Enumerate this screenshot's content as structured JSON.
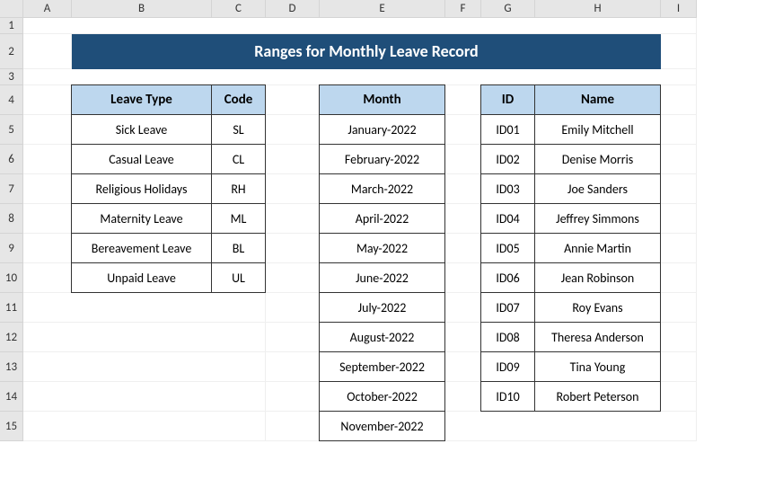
{
  "columns": [
    "A",
    "B",
    "C",
    "D",
    "E",
    "F",
    "G",
    "H",
    "I"
  ],
  "rows": [
    "1",
    "2",
    "3",
    "4",
    "5",
    "6",
    "7",
    "8",
    "9",
    "10",
    "11",
    "12",
    "13",
    "14",
    "15"
  ],
  "title": "Ranges for Monthly Leave Record",
  "leaveTable": {
    "headers": {
      "type": "Leave Type",
      "code": "Code"
    },
    "rows": [
      {
        "type": "Sick Leave",
        "code": "SL"
      },
      {
        "type": "Casual Leave",
        "code": "CL"
      },
      {
        "type": "Religious Holidays",
        "code": "RH"
      },
      {
        "type": "Maternity Leave",
        "code": "ML"
      },
      {
        "type": "Bereavement Leave",
        "code": "BL"
      },
      {
        "type": "Unpaid Leave",
        "code": "UL"
      }
    ]
  },
  "monthTable": {
    "header": "Month",
    "rows": [
      "January-2022",
      "February-2022",
      "March-2022",
      "April-2022",
      "May-2022",
      "June-2022",
      "July-2022",
      "August-2022",
      "September-2022",
      "October-2022",
      "November-2022"
    ]
  },
  "employeeTable": {
    "headers": {
      "id": "ID",
      "name": "Name"
    },
    "rows": [
      {
        "id": "ID01",
        "name": "Emily Mitchell"
      },
      {
        "id": "ID02",
        "name": "Denise Morris"
      },
      {
        "id": "ID03",
        "name": "Joe Sanders"
      },
      {
        "id": "ID04",
        "name": "Jeffrey Simmons"
      },
      {
        "id": "ID05",
        "name": "Annie Martin"
      },
      {
        "id": "ID06",
        "name": "Jean Robinson"
      },
      {
        "id": "ID07",
        "name": "Roy Evans"
      },
      {
        "id": "ID08",
        "name": "Theresa Anderson"
      },
      {
        "id": "ID09",
        "name": "Tina Young"
      },
      {
        "id": "ID10",
        "name": "Robert Peterson"
      }
    ]
  }
}
